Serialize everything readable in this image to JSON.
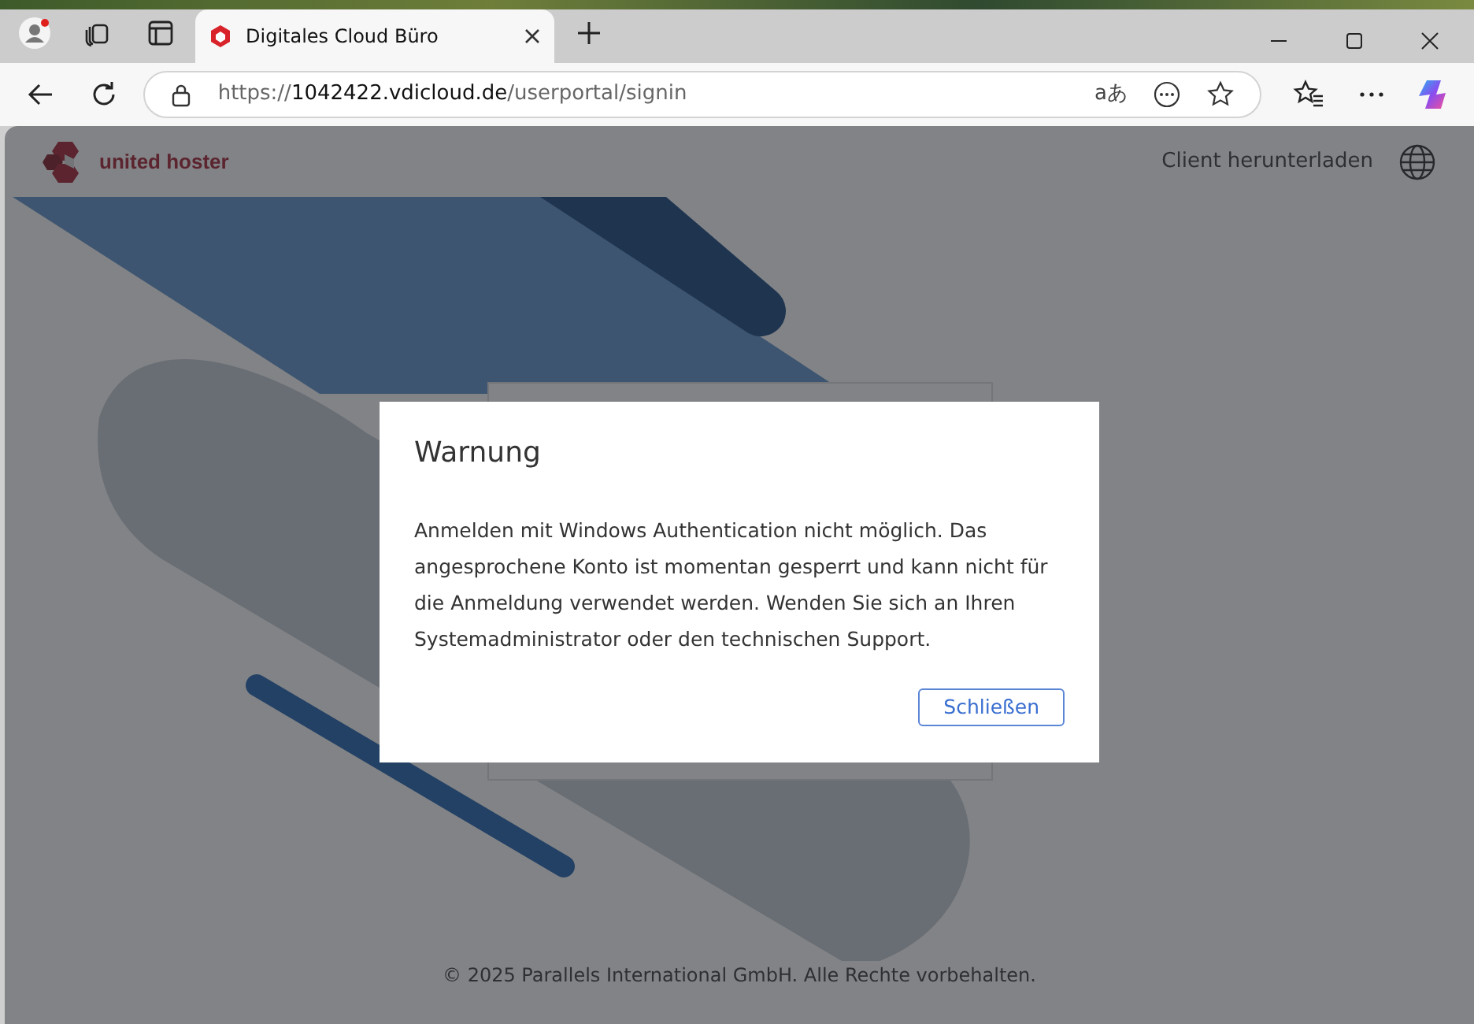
{
  "browser": {
    "tab_title": "Digitales Cloud Büro",
    "url": "https://**1042422.vdicloud.de**/userportal/signin",
    "translate_glyph": "aあ"
  },
  "header": {
    "brand": "united hoster",
    "download_link": "Client herunterladen"
  },
  "dialog": {
    "title": "Warnung",
    "message": "Anmelden mit Windows Authentication nicht möglich. Das angesprochene Konto ist momentan gesperrt und kann nicht für die Anmeldung verwendet werden. Wenden Sie sich an Ihren Systemadministrator oder den technischen Support.",
    "buttons": [
      "Schließen"
    ]
  },
  "footer": "© 2025 Parallels International GmbH. Alle Rechte vorbehalten."
}
